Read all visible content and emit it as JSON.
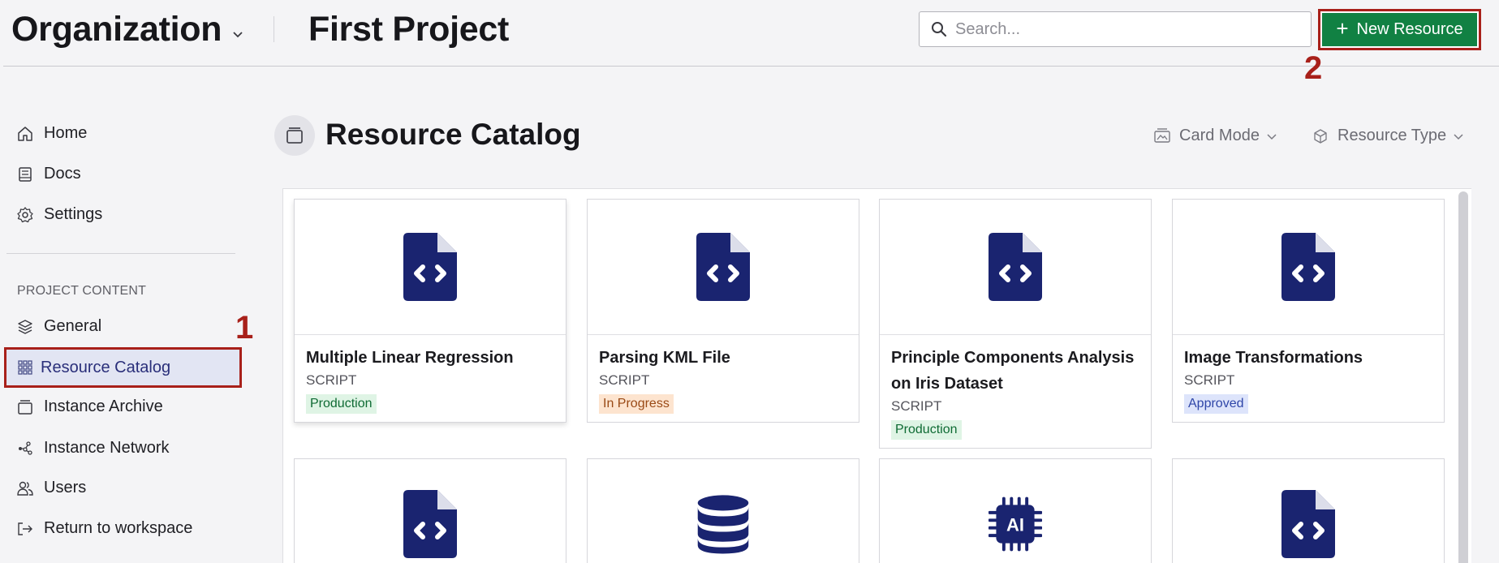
{
  "header": {
    "organization": "Organization",
    "project": "First Project",
    "search_placeholder": "Search...",
    "new_resource_label": "New Resource"
  },
  "callouts": [
    "1",
    "2"
  ],
  "sidebar": {
    "top_items": [
      {
        "label": "Home",
        "icon": "home-icon"
      },
      {
        "label": "Docs",
        "icon": "docs-icon"
      },
      {
        "label": "Settings",
        "icon": "settings-icon"
      }
    ],
    "section_label": "PROJECT CONTENT",
    "content_items": [
      {
        "label": "General",
        "icon": "layers-icon"
      },
      {
        "label": "Resource Catalog",
        "icon": "grid-icon",
        "active": true
      },
      {
        "label": "Instance Archive",
        "icon": "archive-icon"
      },
      {
        "label": "Instance Network",
        "icon": "network-icon"
      },
      {
        "label": "Users",
        "icon": "users-icon"
      },
      {
        "label": "Return to workspace",
        "icon": "exit-icon"
      }
    ]
  },
  "main": {
    "title": "Resource Catalog",
    "view_mode": "Card Mode",
    "filter": "Resource Type",
    "cards": [
      {
        "title": "Multiple Linear Regression",
        "type": "SCRIPT",
        "status": "Production",
        "icon": "code-file-icon"
      },
      {
        "title": "Parsing KML File",
        "type": "SCRIPT",
        "status": "In Progress",
        "icon": "code-file-icon"
      },
      {
        "title": "Principle Components Analysis on Iris Dataset",
        "type": "SCRIPT",
        "status": "Production",
        "icon": "code-file-icon"
      },
      {
        "title": "Image Transformations",
        "type": "SCRIPT",
        "status": "Approved",
        "icon": "code-file-icon"
      }
    ],
    "cards_row2_icons": [
      "code-file-icon",
      "database-icon",
      "ai-chip-icon",
      "code-file-icon"
    ]
  },
  "colors": {
    "accent_green": "#118143",
    "annotation_red": "#a8201a",
    "icon_navy": "#1a2470",
    "active_bg": "#e2e5f3"
  }
}
